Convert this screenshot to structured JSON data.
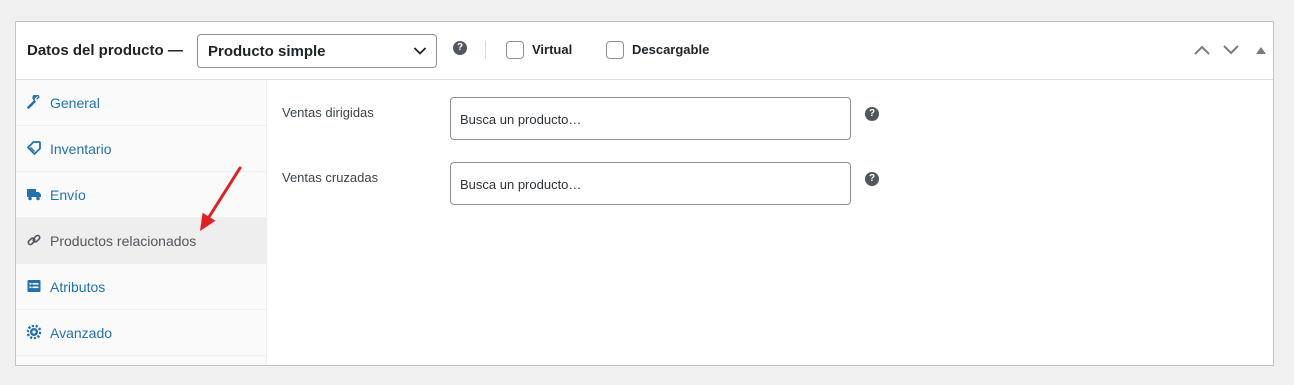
{
  "header": {
    "title": "Datos del producto —",
    "product_type": "Producto simple",
    "help_glyph": "?",
    "virtual_label": "Virtual",
    "downloadable_label": "Descargable",
    "virtual_checked": false,
    "downloadable_checked": false
  },
  "sidebar": {
    "items": [
      {
        "label": "General",
        "icon": "wrench-icon"
      },
      {
        "label": "Inventario",
        "icon": "tag-icon"
      },
      {
        "label": "Envío",
        "icon": "truck-icon"
      },
      {
        "label": "Productos relacionados",
        "icon": "link-icon",
        "active": true
      },
      {
        "label": "Atributos",
        "icon": "list-icon"
      },
      {
        "label": "Avanzado",
        "icon": "gear-icon"
      }
    ]
  },
  "main": {
    "upsells": {
      "label": "Ventas dirigidas",
      "placeholder": "Busca un producto…"
    },
    "crosssells": {
      "label": "Ventas cruzadas",
      "placeholder": "Busca un producto…"
    }
  },
  "colors": {
    "link": "#2271b1",
    "active_tab_bg": "#eeeeee",
    "annotation_arrow": "#e02020"
  }
}
